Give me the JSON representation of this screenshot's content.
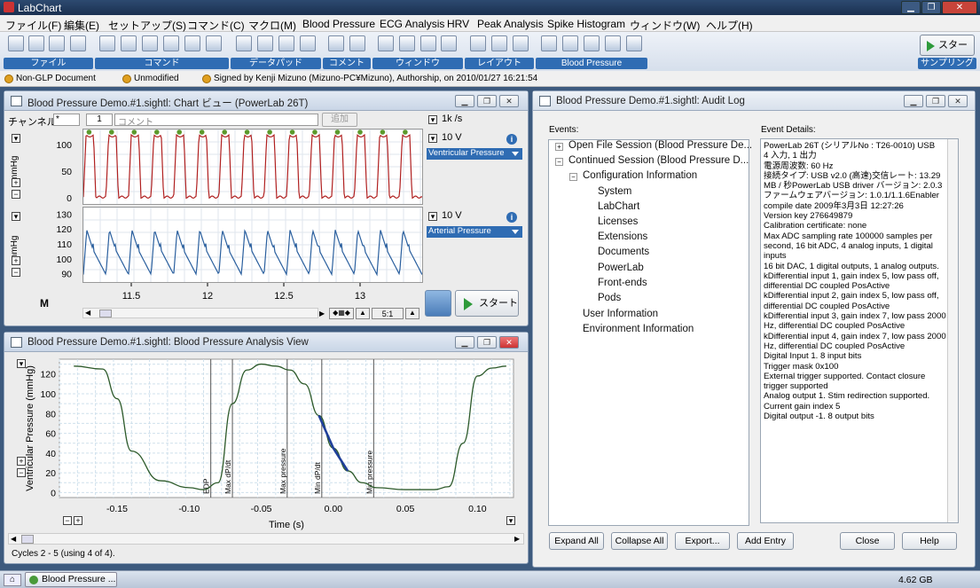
{
  "app": {
    "title": "LabChart"
  },
  "menu": [
    "ファイル(F)",
    "編集(E)",
    "セットアップ(S)",
    "コマンド(C)",
    "マクロ(M)",
    "Blood Pressure",
    "ECG Analysis",
    "HRV",
    "Peak Analysis",
    "Spike Histogram",
    "ウィンドウ(W)",
    "ヘルプ(H)"
  ],
  "toolbar": {
    "groups": [
      "ファイル",
      "コマンド",
      "データパッド",
      "コメント",
      "ウィンドウ",
      "レイアウト",
      "Blood Pressure"
    ],
    "start_label": "スタート",
    "sampling_label": "サンプリング"
  },
  "status": {
    "glp": "Non-GLP Document",
    "modified": "Unmodified",
    "signed": "Signed by Kenji Mizuno (Mizuno-PC¥Mizuno), Authorship, on 2010/01/27 16:21:54"
  },
  "chart_view": {
    "title": "Blood Pressure Demo.#1.sightl: Chart ビュー (PowerLab 26T)",
    "channel_label": "チャンネル:",
    "channel_value": "*",
    "comment_num": "1",
    "comment_placeholder": "コメント",
    "add_label": "追加",
    "rate": "1k /s",
    "range1": "10 V",
    "range2": "10 V",
    "ch1_name": "Ventricular Pressure",
    "ch2_name": "Arterial Pressure",
    "unit1": "mmHg",
    "unit2": "mmHg",
    "ch1_ticks": [
      "100",
      "50",
      "0"
    ],
    "ch2_ticks": [
      "130",
      "120",
      "110",
      "100",
      "90"
    ],
    "x_ticks": [
      "11.5",
      "12",
      "12.5",
      "13"
    ],
    "zoom": "5:1",
    "start_label": "スタート",
    "marker": "M"
  },
  "analysis": {
    "title": "Blood Pressure Demo.#1.sightl: Blood Pressure Analysis View",
    "ylabel": "Ventricular Pressure (mmHg)",
    "xlabel": "Time (s)",
    "y_ticks": [
      "120",
      "100",
      "80",
      "60",
      "40",
      "20",
      "0"
    ],
    "x_ticks": [
      "-0.15",
      "-0.10",
      "-0.05",
      "0.00",
      "0.05",
      "0.10"
    ],
    "markers": [
      "EDP",
      "Max dP/dt",
      "Max pressure",
      "Min dP/dt",
      "Min pressure"
    ],
    "footer": "Cycles 2 - 5 (using 4 of 4)."
  },
  "chart_data": [
    {
      "type": "line",
      "xlabel": "",
      "ylabel": "mmHg",
      "x_ticks": [
        "11.5",
        "12",
        "12.5",
        "13"
      ],
      "series": [
        {
          "name": "Ventricular Pressure",
          "cycles": 15,
          "peak": 120,
          "trough": 3,
          "ylim": [
            -10,
            130
          ]
        },
        {
          "name": "Arterial Pressure",
          "cycles": 15,
          "peak": 120,
          "trough": 90,
          "ylim": [
            85,
            135
          ]
        }
      ]
    },
    {
      "type": "line",
      "xlabel": "Time (s)",
      "ylabel": "Ventricular Pressure (mmHg)",
      "xlim": [
        -0.19,
        0.125
      ],
      "ylim": [
        -5,
        135
      ],
      "x": [
        -0.18,
        -0.16,
        -0.15,
        -0.14,
        -0.12,
        -0.1,
        -0.09,
        -0.08,
        -0.07,
        -0.06,
        -0.05,
        -0.04,
        -0.03,
        -0.02,
        -0.01,
        0.0,
        0.01,
        0.02,
        0.03,
        0.05,
        0.07,
        0.08,
        0.09,
        0.1,
        0.11,
        0.12
      ],
      "y": [
        128,
        125,
        95,
        42,
        12,
        5,
        3,
        10,
        90,
        124,
        130,
        128,
        124,
        110,
        78,
        45,
        22,
        10,
        5,
        3,
        3,
        6,
        50,
        118,
        126,
        128
      ],
      "markers": {
        "EDP": -0.085,
        "Max dP/dt": -0.07,
        "Max pressure": -0.032,
        "Min dP/dt": -0.008,
        "Min pressure": 0.028
      }
    }
  ],
  "audit": {
    "title": "Blood Pressure Demo.#1.sightl: Audit Log",
    "events_label": "Events:",
    "details_label": "Event Details:",
    "tree": [
      "Open File Session (Blood Pressure De...",
      "Continued Session (Blood Pressure D...",
      "Configuration Information",
      "System",
      "LabChart",
      "Licenses",
      "Extensions",
      "Documents",
      "PowerLab",
      "Front-ends",
      "Pods",
      "User Information",
      "Environment Information"
    ],
    "details": [
      "PowerLab 26T (シリアルNo : T26-0010) USB",
      "4 入力, 1 出力",
      "電源周波数: 60 Hz",
      "接続タイプ: USB v2.0 (高速)交信レート: 13.29",
      "MB / 秒PowerLab USB driver バージョン: 2.0.3",
      "ファームウェアバージョン: 1.0.1/1.1.6Enabler",
      "compile date 2009年3月3日 12:27:26",
      "Version key 276649879",
      "Calibration certificate: none",
      "Max ADC sampling rate 100000 samples per",
      "second, 16 bit ADC, 4 analog inputs, 1 digital",
      "inputs",
      "16 bit DAC, 1 digital outputs, 1 analog outputs.",
      "kDifferential input 1, gain index 5, low pass off,",
      "differential DC coupled PosActive",
      "kDifferential input 2, gain index 5, low pass off,",
      "differential DC coupled PosActive",
      "kDifferential input 3, gain index 7, low pass 2000",
      "Hz, differential DC coupled PosActive",
      "kDifferential input 4, gain index 7, low pass 2000",
      "Hz, differential DC coupled PosActive",
      " Digital Input 1. 8 input bits",
      "Trigger mask 0x100",
      "External trigger supported. Contact closure",
      "trigger supported",
      " Analog output 1. Stim redirection supported.",
      "Current gain index 5",
      " Digital output -1. 8 output bits"
    ],
    "buttons": [
      "Expand All",
      "Collapse All",
      "Export...",
      "Add Entry",
      "Close",
      "Help"
    ]
  },
  "taskbar": {
    "item": "Blood Pressure ...",
    "disk": "4.62 GB"
  }
}
